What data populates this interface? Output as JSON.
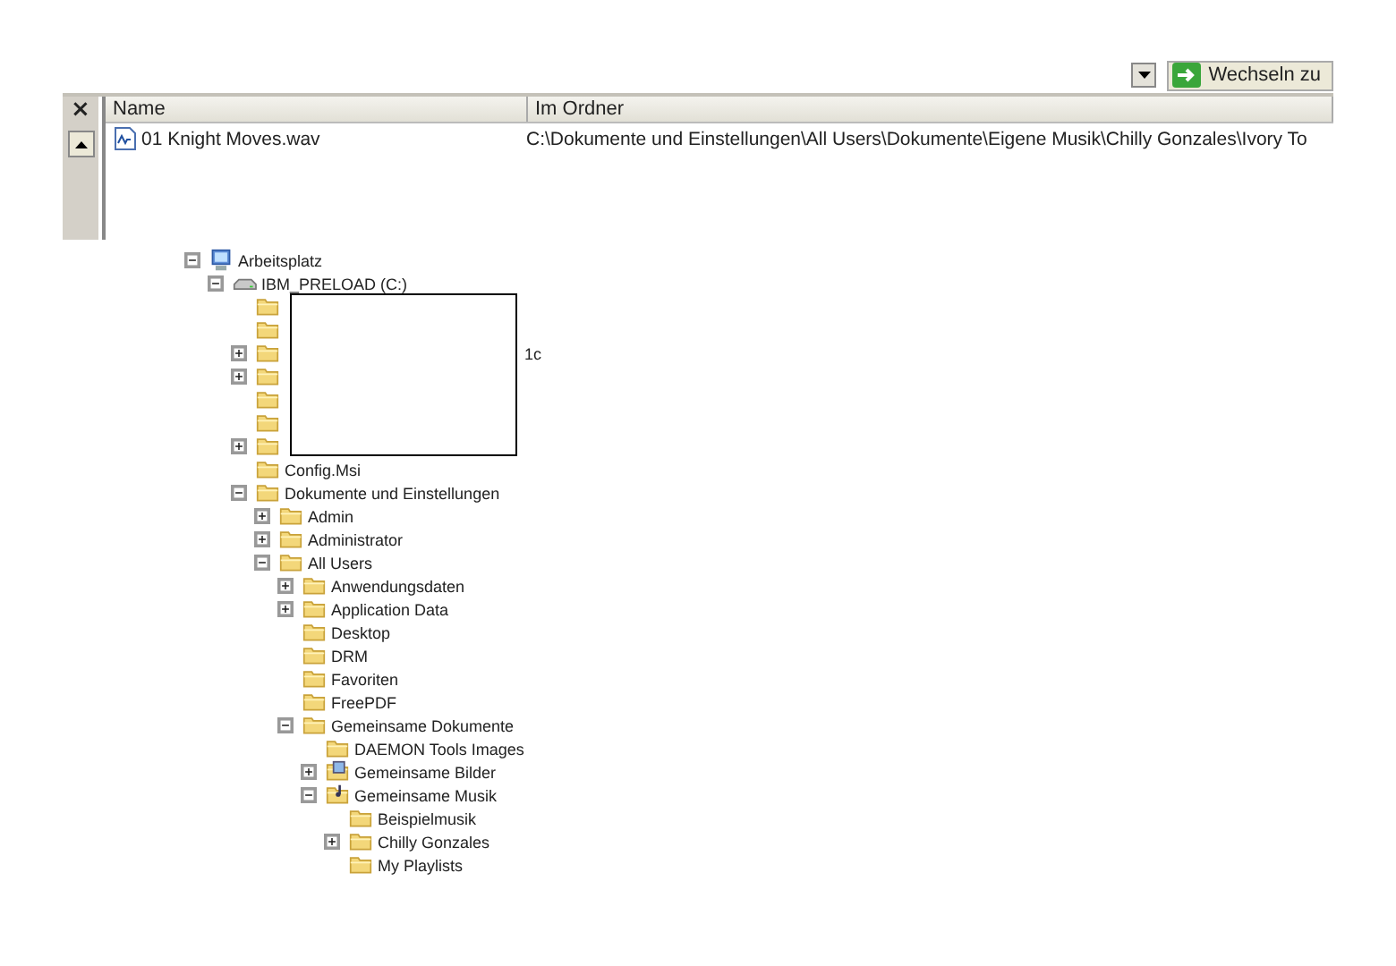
{
  "toolbar": {
    "go_button": "Wechseln zu"
  },
  "results": {
    "close": "×",
    "columns": [
      "Name",
      "Im Ordner"
    ],
    "rows": [
      {
        "name": "01 Knight Moves.wav",
        "folder": "C:\\Dokumente und Einstellungen\\All Users\\Dokumente\\Eigene Musik\\Chilly Gonzales\\Ivory To"
      }
    ]
  },
  "tree": [
    {
      "label": "Arbeitsplatz",
      "kind": "computer",
      "expanded": true,
      "children": [
        {
          "label": "IBM_PRELOAD (C:)",
          "kind": "drive",
          "expanded": true,
          "children": [
            {
              "kind": "redacted-folder"
            },
            {
              "kind": "redacted-folder"
            },
            {
              "kind": "redacted-folder",
              "expanded": false,
              "label": "1c"
            },
            {
              "kind": "redacted-folder",
              "expanded": false
            },
            {
              "kind": "redacted-folder"
            },
            {
              "kind": "redacted-folder"
            },
            {
              "kind": "redacted-folder",
              "expanded": false
            },
            {
              "label": "Config.Msi",
              "kind": "folder"
            },
            {
              "label": "Dokumente und Einstellungen",
              "kind": "folder",
              "expanded": true,
              "children": [
                {
                  "label": "Admin",
                  "kind": "folder",
                  "expanded": false
                },
                {
                  "label": "Administrator",
                  "kind": "folder",
                  "expanded": false
                },
                {
                  "label": "All Users",
                  "kind": "folder",
                  "expanded": true,
                  "children": [
                    {
                      "label": "Anwendungsdaten",
                      "kind": "folder",
                      "expanded": false
                    },
                    {
                      "label": "Application Data",
                      "kind": "folder",
                      "expanded": false
                    },
                    {
                      "label": "Desktop",
                      "kind": "folder"
                    },
                    {
                      "label": "DRM",
                      "kind": "folder"
                    },
                    {
                      "label": "Favoriten",
                      "kind": "folder"
                    },
                    {
                      "label": "FreePDF",
                      "kind": "folder"
                    },
                    {
                      "label": "Gemeinsame Dokumente",
                      "kind": "folder",
                      "expanded": true,
                      "children": [
                        {
                          "label": "DAEMON Tools Images",
                          "kind": "folder"
                        },
                        {
                          "label": "Gemeinsame Bilder",
                          "kind": "picture-folder",
                          "expanded": false
                        },
                        {
                          "label": "Gemeinsame Musik",
                          "kind": "music-folder",
                          "expanded": true,
                          "children": [
                            {
                              "label": "Beispielmusik",
                              "kind": "folder"
                            },
                            {
                              "label": "Chilly Gonzales",
                              "kind": "folder",
                              "expanded": false
                            },
                            {
                              "label": "My Playlists",
                              "kind": "folder"
                            }
                          ]
                        }
                      ]
                    }
                  ]
                }
              ]
            }
          ]
        }
      ]
    }
  ]
}
